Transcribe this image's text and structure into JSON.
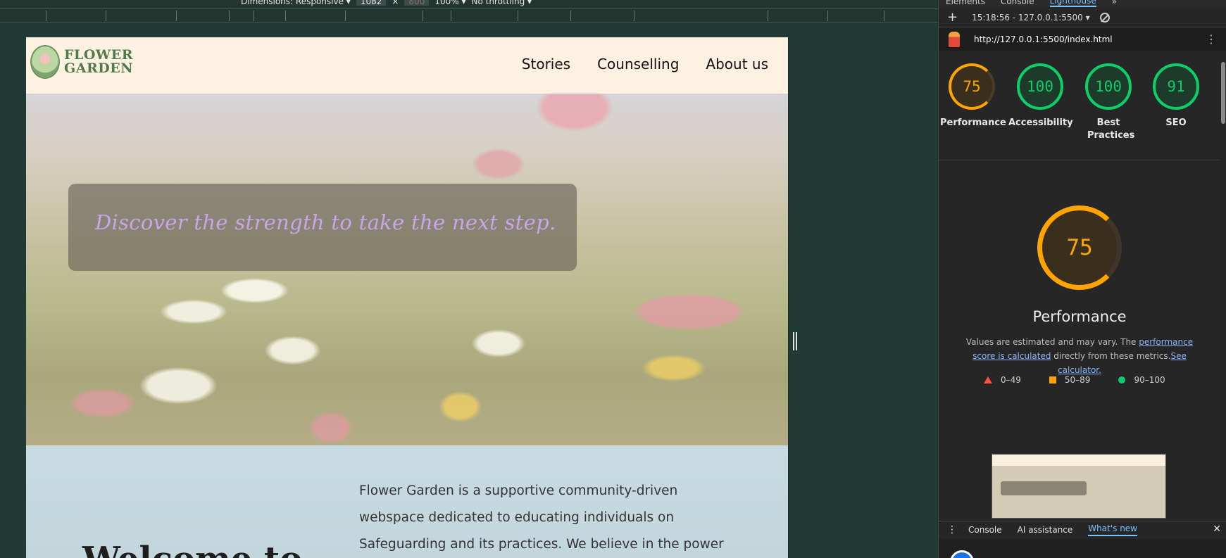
{
  "device_toolbar": {
    "dimensions_label": "Dimensions: Responsive ▾",
    "width_value": "1082",
    "height_value": "800",
    "zoom": "100% ▾",
    "throttling": "No throttling ▾"
  },
  "site": {
    "logo_line1": "FLOWER",
    "logo_line2": "GARDEN",
    "nav": [
      "Stories",
      "Counselling",
      "About us"
    ],
    "hero_quote": "Discover the strength to take the next step.",
    "about_text": "Flower Garden is a supportive community-driven webspace dedicated to educating individuals on Safeguarding and its practices. We believe in the power of sharing stories and",
    "about_heading": "Welcome to"
  },
  "devtools": {
    "tabs": [
      "Elements",
      "Console",
      "Lighthouse",
      "»"
    ],
    "session": "15:18:56 - 127.0.0.1:5500 ▾",
    "url": "http://127.0.0.1:5500/index.html",
    "scores": [
      {
        "value": "75",
        "label": "Performance",
        "status": "average"
      },
      {
        "value": "100",
        "label": "Accessibility",
        "status": "pass"
      },
      {
        "value": "100",
        "label": "Best Practices",
        "status": "pass"
      },
      {
        "value": "91",
        "label": "SEO",
        "status": "pass"
      }
    ],
    "main_score": "75",
    "main_title": "Performance",
    "note_prefix": "Values are estimated and may vary. The ",
    "note_link1": "performance score is calculated",
    "note_middle": " directly from these metrics.",
    "note_link2": "See calculator.",
    "legend": [
      "0–49",
      "50–89",
      "90–100"
    ],
    "drawer_tabs": [
      "Console",
      "AI assistance",
      "What's new"
    ],
    "colors": {
      "pass": "#0cce6b",
      "average": "#ffa400",
      "fail": "#ff4e42"
    }
  }
}
